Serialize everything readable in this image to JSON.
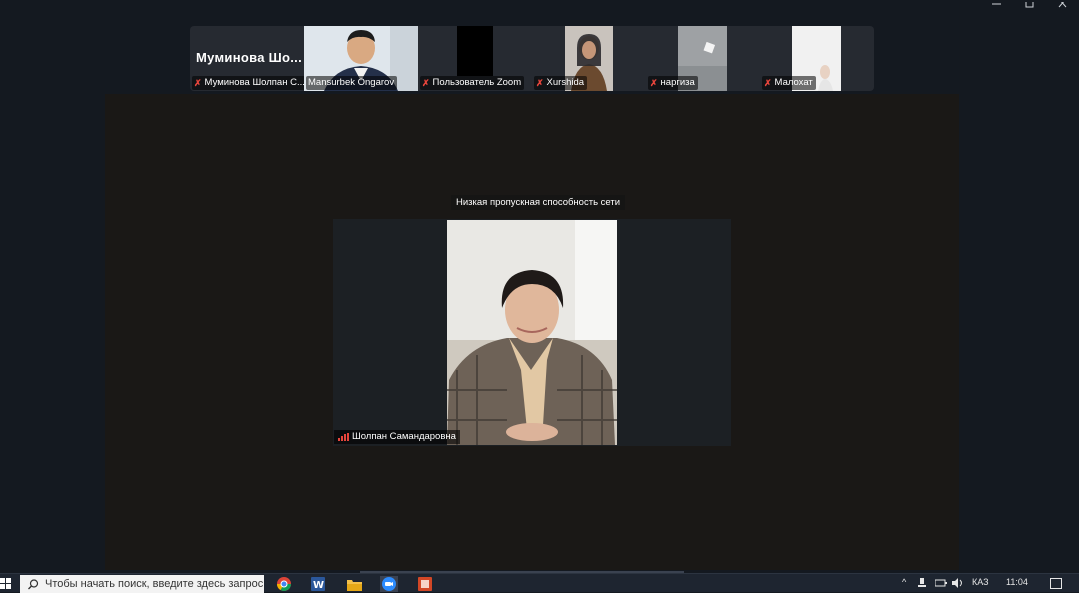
{
  "window": {
    "minimize_icon": "minimize-icon",
    "maximize_icon": "restore-icon",
    "close_icon": "close-icon"
  },
  "strip": {
    "tiles": [
      {
        "name": "Муминова Шолпан С...",
        "display_name": "Муминова  Шо...",
        "muted": true
      },
      {
        "name": "Mansurbek Ongarov",
        "muted": false
      },
      {
        "name": "Пользователь Zoom",
        "muted": true
      },
      {
        "name": "Xurshida",
        "muted": true
      },
      {
        "name": "наргиза",
        "muted": true
      },
      {
        "name": "Малохат",
        "muted": true
      }
    ]
  },
  "stage": {
    "network_notice": "Низкая пропускная способность сети",
    "speaker_name": "Шолпан Самандаровна"
  },
  "taskbar": {
    "search_placeholder": "Чтобы начать поиск, введите здесь запрос",
    "language": "КАЗ",
    "time": "11:04"
  },
  "colors": {
    "background": "#141920",
    "stage": "#1a1816",
    "muted_mic": "#e8453c"
  }
}
